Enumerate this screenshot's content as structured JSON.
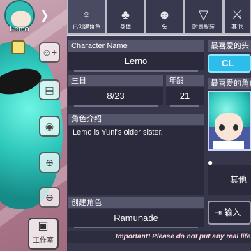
{
  "character": {
    "name_label": "Lemo",
    "back_icon": "chevron-right-icon"
  },
  "sidebar": {
    "buttons": [
      {
        "icon": "add-person-icon",
        "glyph": "☺+"
      },
      {
        "icon": "id-card-icon",
        "glyph": "▤"
      },
      {
        "icon": "eye-icon",
        "glyph": "◉"
      },
      {
        "icon": "zoom-in-icon",
        "glyph": "⊕"
      },
      {
        "icon": "zoom-out-icon",
        "glyph": "⊖"
      }
    ],
    "studio_label": "工作室",
    "studio_icon": "camera-icon"
  },
  "tabs": [
    {
      "label": "已创建角色",
      "icon": "figure-icon",
      "glyph": "♀"
    },
    {
      "label": "身体",
      "icon": "jacket-icon",
      "glyph": "♣"
    },
    {
      "label": "头",
      "icon": "head-icon",
      "glyph": "☻"
    },
    {
      "label": "时尚服装",
      "icon": "shirt-icon",
      "glyph": "▽"
    },
    {
      "label": "其他",
      "icon": "sword-icon",
      "glyph": "⚔"
    }
  ],
  "form": {
    "character_name_label": "Character Name",
    "character_name_value": "Lemo",
    "birthday_label": "生日",
    "birthday_value": "8/23",
    "age_label": "年龄",
    "age_value": "21",
    "profile_label": "角色介绍",
    "profile_value": "Lemo is Yuni's older sister.",
    "creator_label": "创建角色",
    "creator_value": "Ramunade"
  },
  "right_panel": {
    "fav_head_label": "最喜爱的头",
    "fav_head_button": "CL",
    "fav_character_label": "最喜爱的角色",
    "other_label": "其他",
    "import_label": "输入"
  },
  "warning_text": "Important! Please do not put any real life"
}
